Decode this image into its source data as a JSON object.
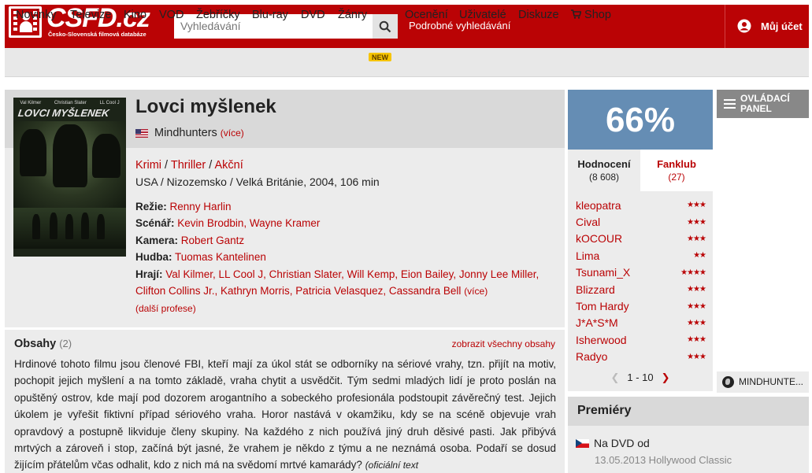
{
  "header": {
    "logo_text": "CSFD.cz",
    "logo_tagline": "Česko-Slovenská filmová databáze",
    "search_placeholder": "Vyhledávání",
    "advanced_search": "Podrobné vyhledávání",
    "account": "Můj účet"
  },
  "nav": {
    "items": [
      "Novinky",
      "Televize",
      "Kino",
      "VOD",
      "Žebříčky",
      "Blu-ray",
      "DVD",
      "Žánry",
      "Ocenění",
      "Uživatelé",
      "Diskuze",
      "Shop"
    ],
    "new_badge": "NEW"
  },
  "film": {
    "poster_names": [
      "Val Kilmer",
      "Christian Slater",
      "LL Cool J"
    ],
    "poster_title": "LOVCI MYŠLENEK",
    "title": "Lovci myšlenek",
    "orig_title": "Mindhunters",
    "more": "(více)",
    "genres": [
      "Krimi",
      "Thriller",
      "Akční"
    ],
    "origin": "USA / Nizozemsko / Velká Británie, 2004, 106 min",
    "crew": {
      "directing_label": "Režie:",
      "directing": "Renny Harlin",
      "writing_label": "Scénář:",
      "writing": "Kevin Brodbin, Wayne Kramer",
      "camera_label": "Kamera:",
      "camera": "Robert Gantz",
      "music_label": "Hudba:",
      "music": "Tuomas Kantelinen",
      "cast_label": "Hrají:",
      "cast_line1": "Val Kilmer, LL Cool J, Christian Slater, Will Kemp, Eion Bailey, Jonny Lee Miller,",
      "cast_line2": "Clifton Collins Jr., Kathryn Morris, Patricia Velasquez, Cassandra Bell",
      "cast_more": "(více)",
      "more_professions": "(další profese)"
    }
  },
  "plot": {
    "heading": "Obsahy",
    "count": "(2)",
    "show_all": "zobrazit všechny obsahy",
    "text": "Hrdinové tohoto filmu jsou členové FBI, kteří mají za úkol stát se odborníky na sériové vrahy, tzn. přijít na motiv, pochopit jejich myšlení a na tomto základě, vraha chytit a usvědčit. Tým sedmi mladých lidí je proto poslán na opuštěný ostrov, kde mají pod dozorem arogantního a sobeckého profesionála podstoupit závěrečný test. Jejich úkolem je vyřešit fiktivní případ sériového vraha. Horor nastává v okamžiku, kdy se na scéně objevuje vrah opravdový a postupně likviduje členy skupiny. Na každého z nich používá jiný druh děsivé pasti. Jak přibývá mrtvých a zároveň i stop, začíná být jasné, že vrahem je někdo z týmu a ne neznámá osoba. Podaří se dosud žijícím přátelům včas odhalit, kdo z nich má na svědomí mrtvé kamarády?",
    "source": "(oficiální text"
  },
  "rating": {
    "score": "66%",
    "tab_ratings": "Hodnocení",
    "tab_ratings_count": "(8 608)",
    "tab_fanclub": "Fanklub",
    "tab_fanclub_count": "(27)",
    "users": [
      {
        "name": "kleopatra",
        "stars": "★★★"
      },
      {
        "name": "Cival",
        "stars": "★★★"
      },
      {
        "name": "kOCOUR",
        "stars": "★★★"
      },
      {
        "name": "Lima",
        "stars": "★★"
      },
      {
        "name": "Tsunami_X",
        "stars": "★★★★"
      },
      {
        "name": "Blizzard",
        "stars": "★★★"
      },
      {
        "name": "Tom Hardy",
        "stars": "★★★"
      },
      {
        "name": "J*A*S*M",
        "stars": "★★★"
      },
      {
        "name": "Isherwood",
        "stars": "★★★"
      },
      {
        "name": "Radyo",
        "stars": "★★★"
      }
    ],
    "pager": "1 - 10"
  },
  "premieres": {
    "heading": "Premiéry",
    "label": "Na DVD od",
    "detail": "13.05.2013 Hollywood Classic"
  },
  "side": {
    "control_panel": "OVLÁDACÍ PANEL",
    "mindhunters_link": "MINDHUNTE..."
  }
}
